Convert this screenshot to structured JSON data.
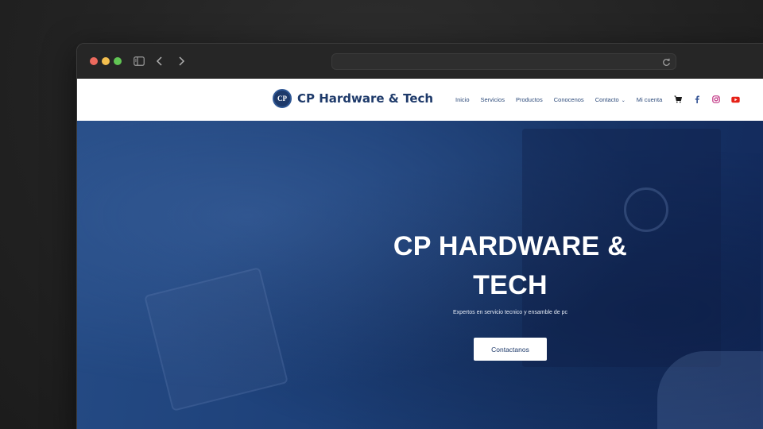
{
  "browser": {
    "address_value": "",
    "icons": [
      "sidebar-icon",
      "back-icon",
      "forward-icon",
      "reload-icon"
    ]
  },
  "site": {
    "logo_mark": "CP",
    "brand_name": "CP Hardware & Tech",
    "brand_color": "#1e3a6a",
    "nav": {
      "inicio": "Inicio",
      "servicios": "Servicios",
      "productos": "Productos",
      "conocenos": "Conocenos",
      "contacto": "Contacto",
      "mi_cuenta": "Mi cuenta"
    },
    "nav_icons": [
      "cart-icon",
      "facebook-icon",
      "instagram-icon",
      "youtube-icon"
    ],
    "social_colors": {
      "facebook": "#3b5998",
      "instagram": "#c13584",
      "youtube": "#e62117"
    }
  },
  "hero": {
    "title_line1": "CP HARDWARE &",
    "title_line2": "TECH",
    "subtitle": "Expertos en servicio tecnico y ensamble de pc",
    "cta_label": "Contactanos",
    "overlay_color": "#1d4078"
  }
}
